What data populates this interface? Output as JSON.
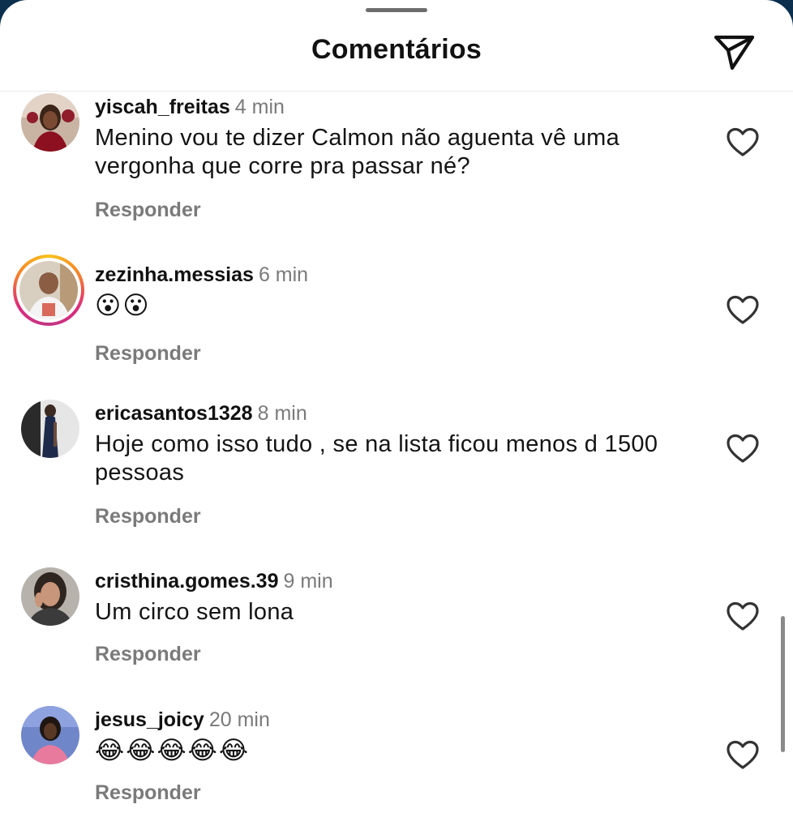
{
  "header": {
    "title": "Comentários",
    "share_icon": "send-icon"
  },
  "comments": [
    {
      "username": "yiscah_freitas",
      "time": "4 min",
      "text": "Menino vou te dizer Calmon não aguenta vê uma vergonha que corre pra passar né?",
      "reply_label": "Responder",
      "liked": false
    },
    {
      "username": "zezinha.messias",
      "time": "6 min",
      "text": "😮😮",
      "reply_label": "Responder",
      "liked": false,
      "has_story": true
    },
    {
      "username": "ericasantos1328",
      "time": "8 min",
      "text": "Hoje como isso tudo , se na lista ficou menos d 1500 pessoas",
      "reply_label": "Responder",
      "liked": false
    },
    {
      "username": "cristhina.gomes.39",
      "time": "9 min",
      "text": "Um circo sem lona",
      "reply_label": "Responder",
      "liked": false
    },
    {
      "username": "jesus_joicy",
      "time": "20 min",
      "text": "😂😂😂😂😂",
      "reply_label": "Responder",
      "liked": false
    }
  ],
  "colors": {
    "background": "#ffffff",
    "username": "#111111",
    "secondary_text": "#7a7a7a",
    "story_ring": [
      "#f7c21b",
      "#dd2a7b"
    ]
  }
}
